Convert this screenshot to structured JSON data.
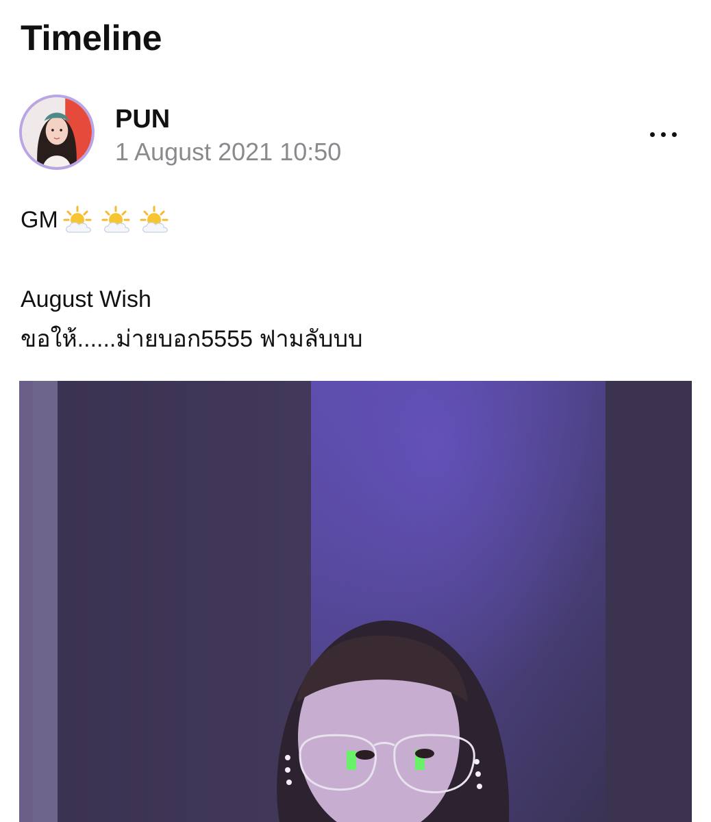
{
  "header": {
    "title": "Timeline"
  },
  "post": {
    "author": "PUN",
    "timestamp": "1 August 2021 10:50",
    "more_icon": "ellipsis-icon",
    "lines": {
      "greeting": "GM",
      "wish_title": "August Wish",
      "wish_text": "ขอให้......ม่ายบอก5555 ฟามลับบบ"
    },
    "emojis": [
      "sun-behind-cloud-icon",
      "sun-behind-cloud-icon",
      "sun-behind-cloud-icon"
    ],
    "colors": {
      "avatar_ring": "#b9a5e6",
      "timestamp": "#8a8a8e",
      "photo_tint": "#5a4c8c"
    }
  }
}
